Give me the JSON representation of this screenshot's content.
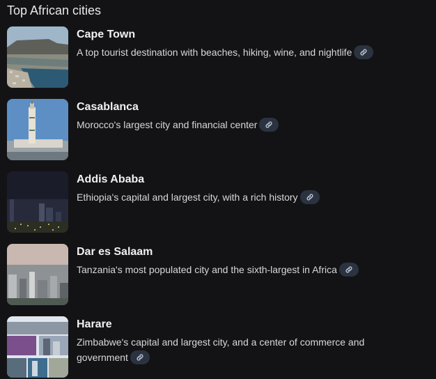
{
  "section_title": "Top African cities",
  "cities": [
    {
      "name": "Cape Town",
      "description": "A top tourist destination with beaches, hiking, wine, and nightlife",
      "image_icon": "cape-town-photo"
    },
    {
      "name": "Casablanca",
      "description": "Morocco's largest city and financial center",
      "image_icon": "casablanca-photo"
    },
    {
      "name": "Addis Ababa",
      "description": "Ethiopia's capital and largest city, with a rich history",
      "image_icon": "addis-ababa-photo"
    },
    {
      "name": "Dar es Salaam",
      "description": "Tanzania's most populated city and the sixth-largest in Africa",
      "image_icon": "dar-es-salaam-photo"
    },
    {
      "name": "Harare",
      "description": "Zimbabwe's capital and largest city, and a center of commerce and government",
      "image_icon": "harare-photo"
    }
  ],
  "colors": {
    "background": "#131316",
    "chip": "#2b3240",
    "link_icon": "#c9d3e3"
  }
}
